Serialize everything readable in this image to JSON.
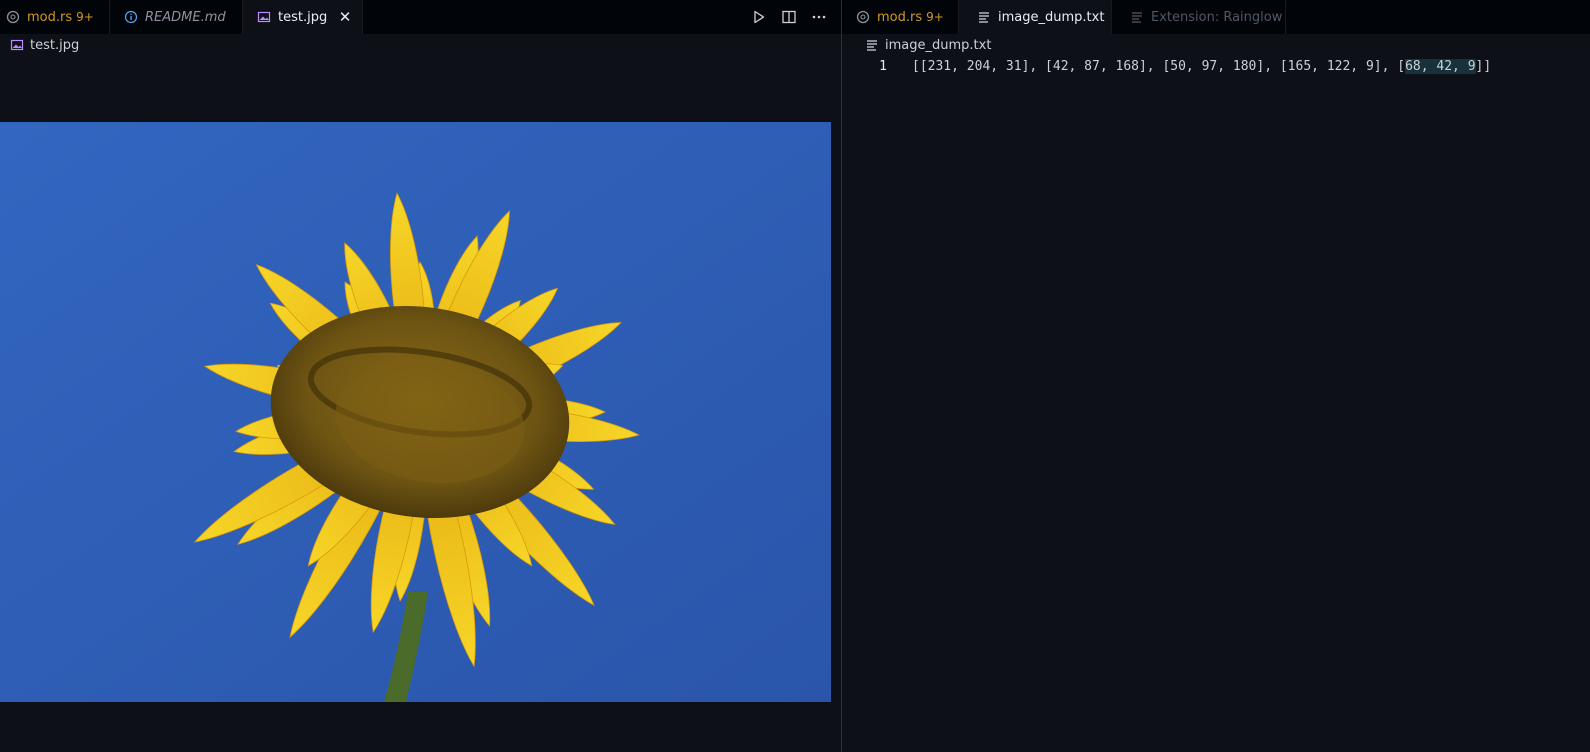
{
  "left_group": {
    "tabs": [
      {
        "label": "mod.rs",
        "badge": "9+",
        "icon": "rust-icon",
        "active": false,
        "color": "#d29922"
      },
      {
        "label": "README.md",
        "icon": "info-icon",
        "active": false,
        "italic": true
      },
      {
        "label": "test.jpg",
        "icon": "image-icon",
        "active": true,
        "close": "✕"
      }
    ],
    "actions": [
      "run-icon",
      "split-editor-icon",
      "more-actions-icon"
    ],
    "breadcrumb": "test.jpg",
    "image": {
      "subject": "sunflower against blue sky",
      "sky_color": "#2f5fb8",
      "petal_color": "#f3c81a",
      "center_color": "#6d5413"
    }
  },
  "right_group": {
    "tabs": [
      {
        "label": "mod.rs",
        "badge": "9+",
        "icon": "rust-icon",
        "active": false,
        "color": "#d29922"
      },
      {
        "label": "image_dump.txt",
        "icon": "text-file-icon",
        "active": true,
        "close": "✕"
      },
      {
        "label": "Extension: Rainglow",
        "icon": "text-file-icon",
        "active": false,
        "dim": true
      }
    ],
    "breadcrumb": "image_dump.txt",
    "editor": {
      "lines": [
        {
          "number": "1",
          "text_before": "[[231, 204, 31], [42, 87, 168], [50, 97, 180], [165, 122, 9], [",
          "text_highlight": "68, 42, 9",
          "text_after": "]]"
        }
      ]
    }
  },
  "colors": {
    "background": "#0d1117",
    "tabbar": "#010409",
    "accent_rust": "#d29922",
    "selection": "#17323a"
  }
}
